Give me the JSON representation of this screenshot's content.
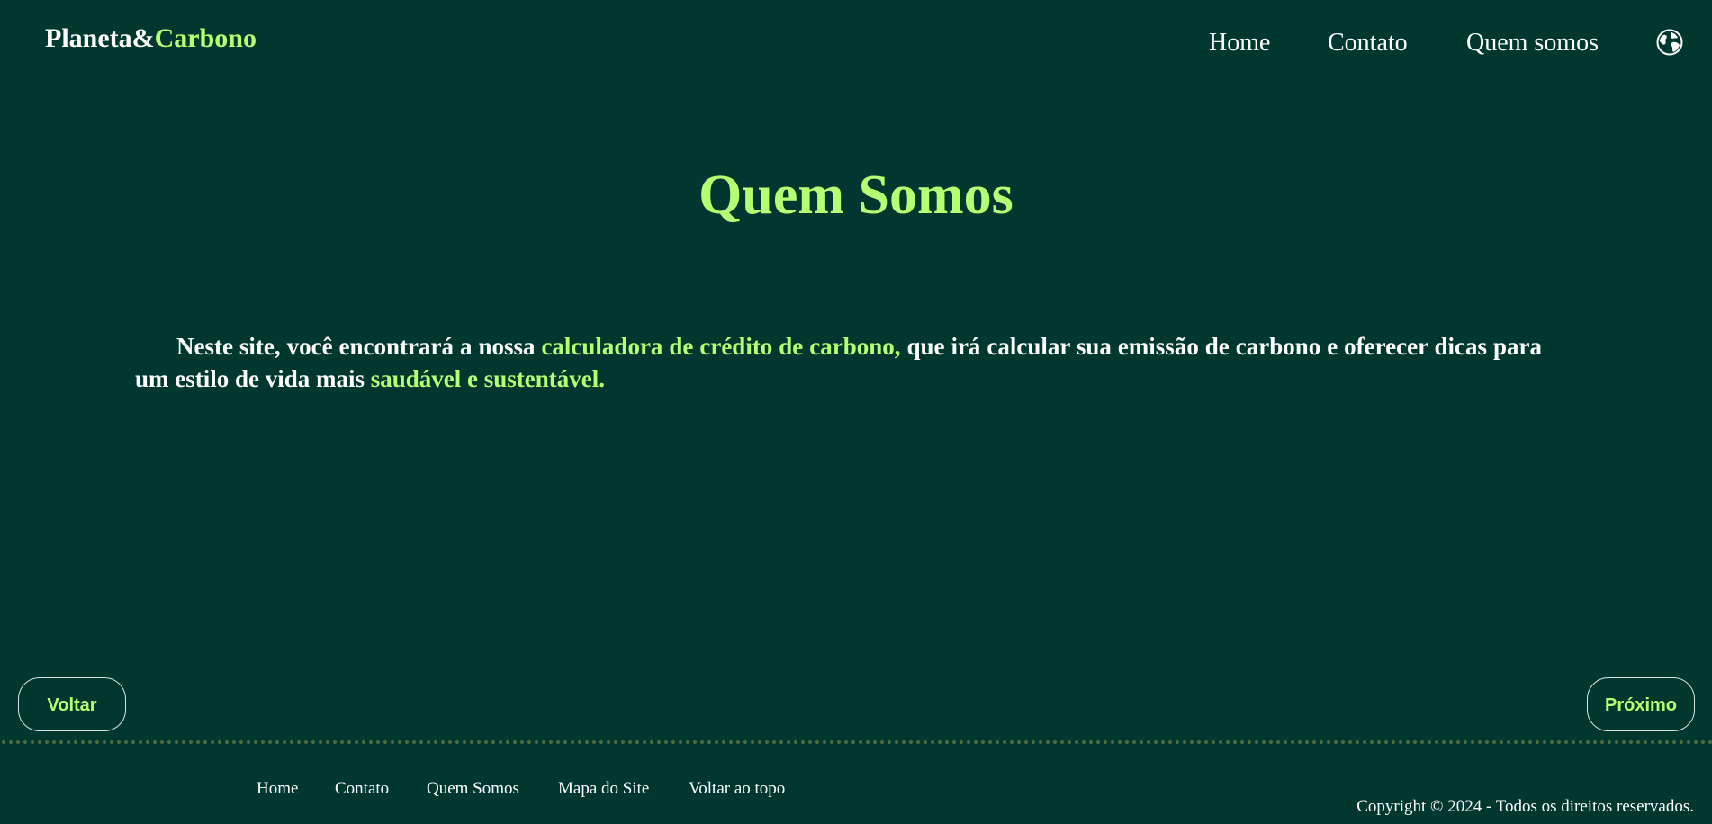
{
  "header": {
    "logo_part1": "Planeta&",
    "logo_part2": "Carbono",
    "nav": {
      "home": "Home",
      "contato": "Contato",
      "quem_somos": "Quem somos"
    },
    "globe_icon": "globe-icon"
  },
  "main": {
    "title": "Quem Somos",
    "intro": {
      "part1": "Neste site, você encontrará a nossa ",
      "highlight1": "calculadora de crédito de carbono,",
      "part2": " que irá calcular sua emissão de carbono e oferecer dicas para um estilo de vida mais ",
      "highlight2": "saudável e sustentável."
    }
  },
  "buttons": {
    "back": "Voltar",
    "next": "Próximo"
  },
  "footer": {
    "links": {
      "home": "Home",
      "contato": "Contato",
      "quem_somos": "Quem Somos",
      "mapa": "Mapa do Site",
      "topo": "Voltar ao topo"
    },
    "copyright": "Copyright © 2024 - Todos os direitos reservados."
  },
  "colors": {
    "background": "#003830",
    "accent": "#b7ff72",
    "text": "#ffffff"
  }
}
